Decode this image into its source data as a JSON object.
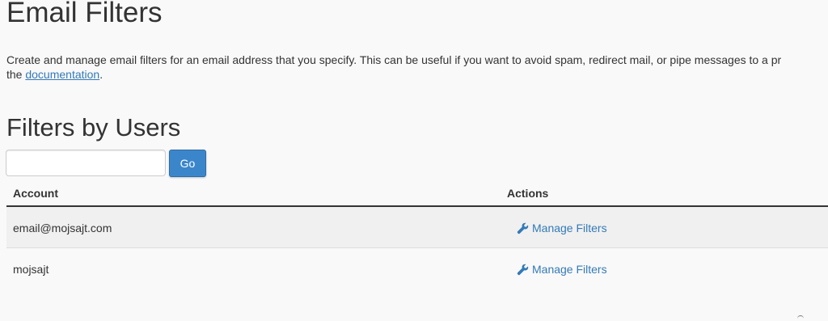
{
  "page": {
    "title": "Email Filters",
    "description_line1": "Create and manage email filters for an email address that you specify. This can be useful if you want to avoid spam, redirect mail, or pipe messages to a pr",
    "description_line2_prefix": "the ",
    "description_link": "documentation",
    "description_line2_suffix": "."
  },
  "filters_section": {
    "title": "Filters by Users",
    "search": {
      "value": "",
      "placeholder": ""
    },
    "go_label": "Go"
  },
  "table": {
    "headers": {
      "account": "Account",
      "actions": "Actions"
    },
    "rows": [
      {
        "account": "email@mojsajt.com",
        "action_label": "Manage Filters",
        "action_icon": "wrench-icon"
      },
      {
        "account": "mojsajt",
        "action_label": "Manage Filters",
        "action_icon": "wrench-icon"
      }
    ]
  },
  "colors": {
    "link": "#337ab7",
    "button_primary": "#3b86cb",
    "background": "#f9f9f9",
    "row_stripe": "#f0f0f0"
  }
}
